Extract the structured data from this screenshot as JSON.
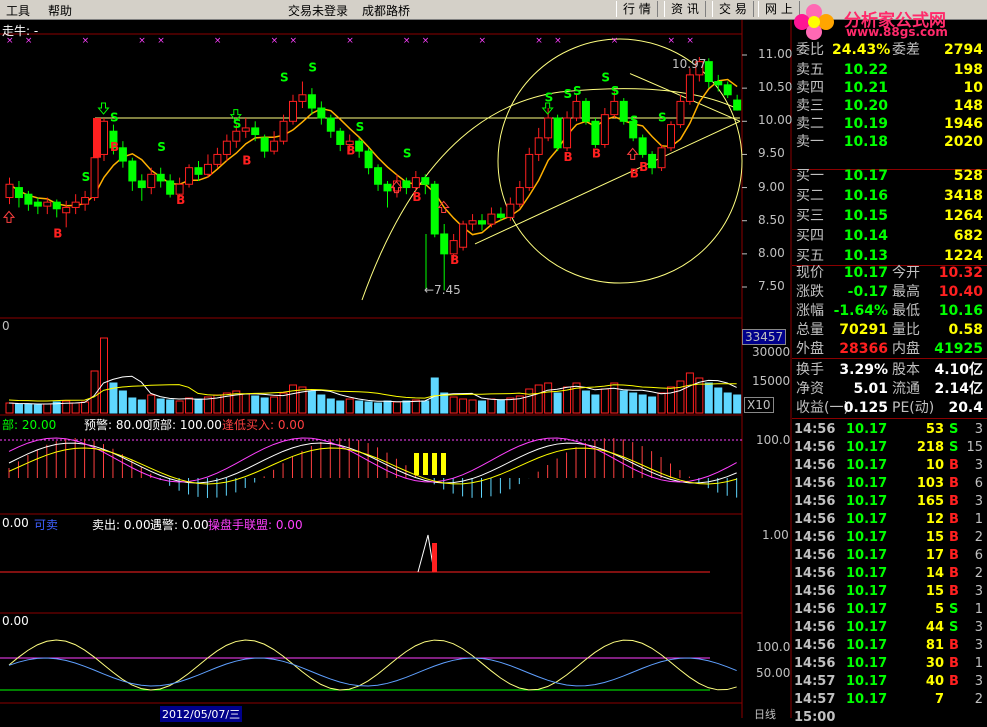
{
  "menu": {
    "tools": "工具",
    "help": "帮助",
    "trade_status": "交易未登录",
    "bridge": "成都路桥",
    "quotes": "行 情",
    "info": "资 讯",
    "trade": "交 易",
    "web": "网 上"
  },
  "logo": {
    "name": "分析家公式网",
    "url": "www.88gs.com"
  },
  "main_chart": {
    "title": "走牛: -",
    "y_ticks": [
      "11.00",
      "10.50",
      "10.00",
      "9.50",
      "9.00",
      "8.50",
      "8.00",
      "7.50"
    ],
    "high_label": "10.97",
    "low_label": "←7.45"
  },
  "volume_panel": {
    "label": "0",
    "current": "33457",
    "ticks": [
      "30000",
      "15000"
    ],
    "multiplier": "X10"
  },
  "panel2": {
    "labels": [
      "部: 20.00",
      "预警: 80.00",
      "顶部: 100.00",
      "逢低买入: 0.00"
    ],
    "tick": "100.0"
  },
  "panel3": {
    "labels": [
      "0.00",
      "可卖",
      "卖出: 0.00",
      "遇警: 0.00",
      "操盘手联盟: 0.00"
    ],
    "tick": "1.00"
  },
  "panel4": {
    "label": "0.00",
    "ticks": [
      "100.0",
      "50.00"
    ]
  },
  "bottom_bar": {
    "date": "2012/05/07/三",
    "right": "日线"
  },
  "quote": {
    "top_row": {
      "l1": "委比",
      "v1": "24.43%",
      "l2": "委差",
      "v2": "2794"
    },
    "asks": [
      {
        "label": "卖五",
        "price": "10.22",
        "vol": "198"
      },
      {
        "label": "卖四",
        "price": "10.21",
        "vol": "10"
      },
      {
        "label": "卖三",
        "price": "10.20",
        "vol": "148"
      },
      {
        "label": "卖二",
        "price": "10.19",
        "vol": "1946"
      },
      {
        "label": "卖一",
        "price": "10.18",
        "vol": "2020"
      }
    ],
    "bids": [
      {
        "label": "买一",
        "price": "10.17",
        "vol": "528"
      },
      {
        "label": "买二",
        "price": "10.16",
        "vol": "3418"
      },
      {
        "label": "买三",
        "price": "10.15",
        "vol": "1264"
      },
      {
        "label": "买四",
        "price": "10.14",
        "vol": "682"
      },
      {
        "label": "买五",
        "price": "10.13",
        "vol": "1224"
      }
    ],
    "info": [
      {
        "l1": "现价",
        "v1": "10.17",
        "l2": "今开",
        "v2": "10.32"
      },
      {
        "l1": "涨跌",
        "v1": "-0.17",
        "l2": "最高",
        "v2": "10.40"
      },
      {
        "l1": "涨幅",
        "v1": "-1.64%",
        "l2": "最低",
        "v2": "10.16"
      },
      {
        "l1": "总量",
        "v1": "70291",
        "l2": "量比",
        "v2": "0.58"
      },
      {
        "l1": "外盘",
        "v1": "28366",
        "l2": "内盘",
        "v2": "41925"
      }
    ],
    "info2": [
      {
        "l1": "换手",
        "v1": "3.29%",
        "l2": "股本",
        "v2": "4.10亿"
      },
      {
        "l1": "净资",
        "v1": "5.01",
        "l2": "流通",
        "v2": "2.14亿"
      },
      {
        "l1": "收益(一)",
        "v1": "0.125",
        "l2": "PE(动)",
        "v2": "20.4"
      }
    ],
    "ticks": [
      {
        "time": "14:56",
        "price": "10.17",
        "vol": "53",
        "dir": "S",
        "num": "3"
      },
      {
        "time": "14:56",
        "price": "10.17",
        "vol": "218",
        "dir": "S",
        "num": "15"
      },
      {
        "time": "14:56",
        "price": "10.17",
        "vol": "10",
        "dir": "B",
        "num": "3"
      },
      {
        "time": "14:56",
        "price": "10.17",
        "vol": "103",
        "dir": "B",
        "num": "6"
      },
      {
        "time": "14:56",
        "price": "10.17",
        "vol": "165",
        "dir": "B",
        "num": "3"
      },
      {
        "time": "14:56",
        "price": "10.17",
        "vol": "12",
        "dir": "B",
        "num": "1"
      },
      {
        "time": "14:56",
        "price": "10.17",
        "vol": "15",
        "dir": "B",
        "num": "2"
      },
      {
        "time": "14:56",
        "price": "10.17",
        "vol": "17",
        "dir": "B",
        "num": "6"
      },
      {
        "time": "14:56",
        "price": "10.17",
        "vol": "14",
        "dir": "B",
        "num": "2"
      },
      {
        "time": "14:56",
        "price": "10.17",
        "vol": "15",
        "dir": "B",
        "num": "3"
      },
      {
        "time": "14:56",
        "price": "10.17",
        "vol": "5",
        "dir": "S",
        "num": "1"
      },
      {
        "time": "14:56",
        "price": "10.17",
        "vol": "44",
        "dir": "S",
        "num": "3"
      },
      {
        "time": "14:56",
        "price": "10.17",
        "vol": "81",
        "dir": "B",
        "num": "3"
      },
      {
        "time": "14:56",
        "price": "10.17",
        "vol": "30",
        "dir": "B",
        "num": "1"
      },
      {
        "time": "14:57",
        "price": "10.17",
        "vol": "40",
        "dir": "B",
        "num": "3"
      },
      {
        "time": "14:57",
        "price": "10.17",
        "vol": "7",
        "dir": "",
        "num": "2"
      },
      {
        "time": "15:00",
        "price": "",
        "vol": "",
        "dir": "",
        "num": ""
      }
    ]
  },
  "colors": {
    "up": "#ff2020",
    "down": "#00ff00",
    "neutral": "#c0c0c0",
    "grid": "#8b0000"
  }
}
